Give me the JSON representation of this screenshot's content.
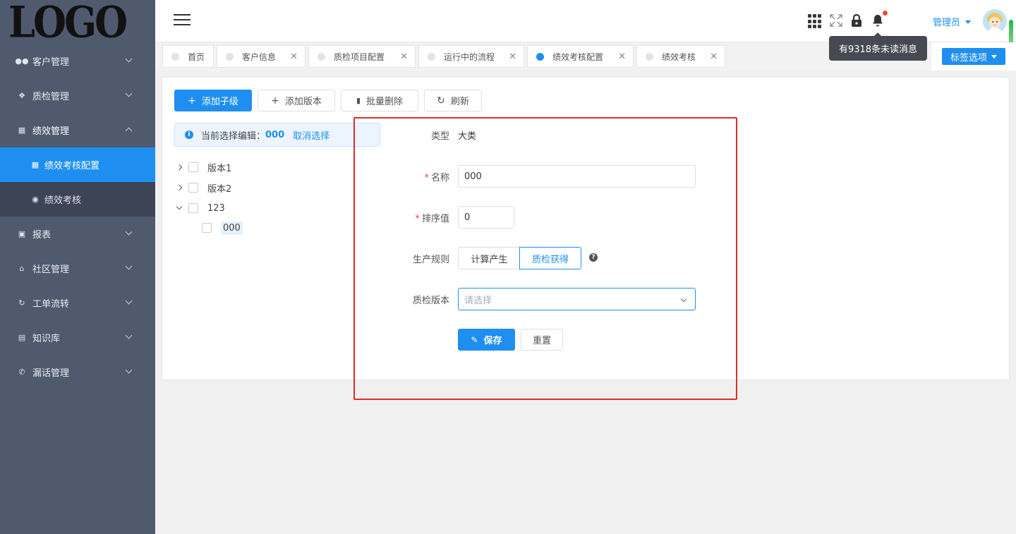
{
  "logo": "LOGO",
  "sidebar": {
    "items": [
      {
        "label": "客户管理",
        "icon": "users-icon"
      },
      {
        "label": "质检管理",
        "icon": "info-icon"
      },
      {
        "label": "绩效管理",
        "icon": "chart-icon"
      },
      {
        "label": "报表",
        "icon": "briefcase-icon"
      },
      {
        "label": "社区管理",
        "icon": "home-icon"
      },
      {
        "label": "工单流转",
        "icon": "refresh-icon"
      },
      {
        "label": "知识库",
        "icon": "book-icon"
      },
      {
        "label": "漏话管理",
        "icon": "phone-icon"
      }
    ],
    "sub_items": [
      {
        "label": "绩效考核配置",
        "active": true
      },
      {
        "label": "绩效考核",
        "active": false
      }
    ]
  },
  "header": {
    "user": "管理员",
    "tooltip": "有9318条未读消息"
  },
  "tabs": [
    {
      "label": "首页"
    },
    {
      "label": "客户信息"
    },
    {
      "label": "质检项目配置"
    },
    {
      "label": "运行中的流程"
    },
    {
      "label": "绩效考核配置",
      "active": true
    },
    {
      "label": "绩效考核"
    }
  ],
  "tag_options": "标签选项",
  "toolbar": {
    "add_child": "添加子级",
    "add_version": "添加版本",
    "batch_delete": "批量删除",
    "refresh": "刷新"
  },
  "info_bar": {
    "prefix": "当前选择编辑：",
    "selected": "000",
    "cancel": "取消选择"
  },
  "tree": [
    {
      "label": "版本1",
      "expanded": false
    },
    {
      "label": "版本2",
      "expanded": false
    },
    {
      "label": "123",
      "expanded": true,
      "children": [
        {
          "label": "000",
          "selected": true
        }
      ]
    }
  ],
  "form": {
    "type_label": "类型",
    "type_value": "大类",
    "name_label": "名称",
    "name_value": "000",
    "sort_label": "排序值",
    "sort_value": "0",
    "rule_label": "生产规则",
    "rule_options": [
      "计算产生",
      "质检获得"
    ],
    "rule_selected": "质检获得",
    "version_label": "质检版本",
    "version_placeholder": "请选择",
    "save": "保存",
    "reset": "重置"
  },
  "colors": {
    "primary": "#1e8ff0",
    "sidebar": "#4f5a6f",
    "highlight": "#e22b2b"
  }
}
